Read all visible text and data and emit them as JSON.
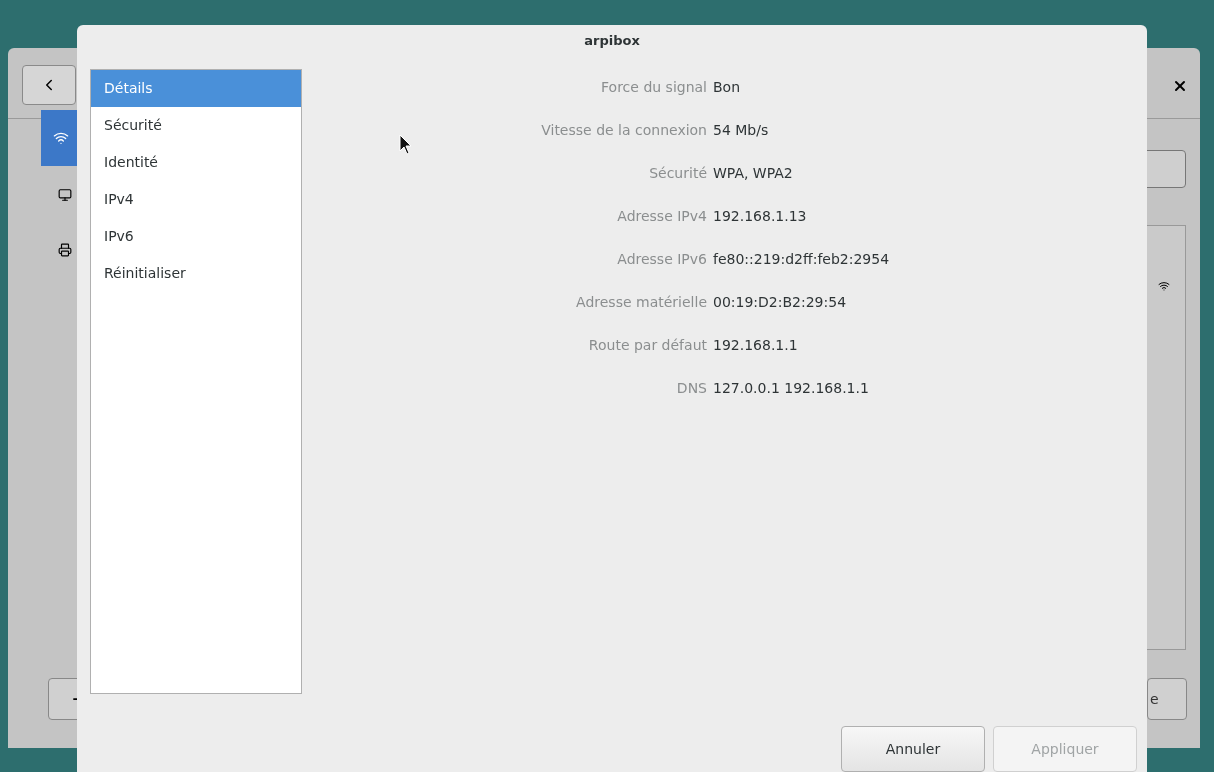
{
  "background_window": {
    "button_text": "e"
  },
  "dialog": {
    "title": "arpibox",
    "sidebar": [
      {
        "label": "Détails",
        "selected": true
      },
      {
        "label": "Sécurité",
        "selected": false
      },
      {
        "label": "Identité",
        "selected": false
      },
      {
        "label": "IPv4",
        "selected": false
      },
      {
        "label": "IPv6",
        "selected": false
      },
      {
        "label": "Réinitialiser",
        "selected": false
      }
    ],
    "details": [
      {
        "label": "Force du signal",
        "value": "Bon"
      },
      {
        "label": "Vitesse de la connexion",
        "value": "54 Mb/s"
      },
      {
        "label": "Sécurité",
        "value": "WPA, WPA2"
      },
      {
        "label": "Adresse IPv4",
        "value": "192.168.1.13"
      },
      {
        "label": "Adresse IPv6",
        "value": "fe80::219:d2ff:feb2:2954"
      },
      {
        "label": "Adresse matérielle",
        "value": "00:19:D2:B2:29:54"
      },
      {
        "label": "Route par défaut",
        "value": "192.168.1.1"
      },
      {
        "label": "DNS",
        "value": "127.0.0.1 192.168.1.1"
      }
    ],
    "buttons": [
      {
        "label": "Annuler",
        "disabled": false
      },
      {
        "label": "Appliquer",
        "disabled": true
      }
    ]
  }
}
